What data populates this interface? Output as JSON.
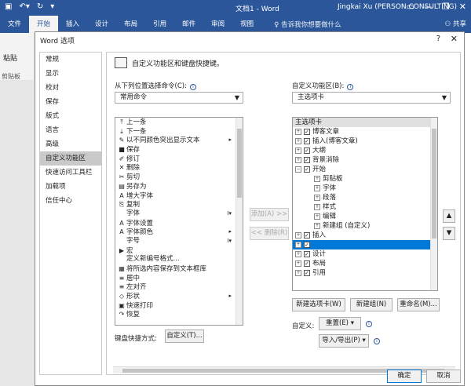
{
  "titlebar": {
    "doc_title": "文档1 - Word",
    "user": "Jingkai Xu (PERSON CONSULTING)",
    "save_icon": "save-icon",
    "undo_icon": "undo-icon",
    "redo_icon": "redo-icon",
    "minimize": "—",
    "restore": "❐",
    "close": "✕"
  },
  "ribbon": {
    "tabs": [
      "文件",
      "开始",
      "插入",
      "设计",
      "布局",
      "引用",
      "邮件",
      "审阅",
      "视图"
    ],
    "tell_me": "♀ 告诉我你想要做什么",
    "share": "共享",
    "paste": "粘贴",
    "clipboard": "剪贴板"
  },
  "dialog": {
    "title": "Word 选项",
    "help": "?",
    "close": "✕",
    "nav": [
      "常规",
      "显示",
      "校对",
      "保存",
      "版式",
      "语言",
      "高级",
      "自定义功能区",
      "快速访问工具栏",
      "加载项",
      "信任中心"
    ],
    "heading": "自定义功能区和键盘快捷键。",
    "from_label": "从下列位置选择命令(C):",
    "from_value": "常用命令",
    "customize_label": "自定义功能区(B):",
    "customize_value": "主选项卡",
    "commands": [
      {
        "icon": "⤒",
        "label": "上一条",
        "sub": ""
      },
      {
        "icon": "⤓",
        "label": "下一条",
        "sub": ""
      },
      {
        "icon": "✎",
        "label": "以不同颜色突出显示文本",
        "sub": "▸"
      },
      {
        "icon": "■",
        "label": "保存",
        "sub": ""
      },
      {
        "icon": "✐",
        "label": "修订",
        "sub": ""
      },
      {
        "icon": "✕",
        "label": "删除",
        "sub": ""
      },
      {
        "icon": "✂",
        "label": "剪切",
        "sub": ""
      },
      {
        "icon": "▤",
        "label": "另存为",
        "sub": ""
      },
      {
        "icon": "A",
        "label": "增大字体",
        "sub": ""
      },
      {
        "icon": "⎘",
        "label": "复制",
        "sub": ""
      },
      {
        "icon": "",
        "label": "字体",
        "sub": "I▾"
      },
      {
        "icon": "A",
        "label": "字体设置",
        "sub": ""
      },
      {
        "icon": "A",
        "label": "字体颜色",
        "sub": "▸"
      },
      {
        "icon": "",
        "label": "字号",
        "sub": "I▾"
      },
      {
        "icon": "▶",
        "label": "宏",
        "sub": ""
      },
      {
        "icon": "",
        "label": "定义新编号格式...",
        "sub": ""
      },
      {
        "icon": "▦",
        "label": "将所选内容保存到文本框库",
        "sub": ""
      },
      {
        "icon": "≡",
        "label": "居中",
        "sub": ""
      },
      {
        "icon": "≡",
        "label": "左对齐",
        "sub": ""
      },
      {
        "icon": "◇",
        "label": "形状",
        "sub": "▸"
      },
      {
        "icon": "▣",
        "label": "快速打印",
        "sub": ""
      },
      {
        "icon": "↷",
        "label": "恢复",
        "sub": ""
      }
    ],
    "add_button": "添加(A) >>",
    "remove_button": "<< 删除(R)",
    "tree": [
      {
        "expander": "",
        "checked": null,
        "indent": 0,
        "label": "主选项卡",
        "selected": false,
        "header": true
      },
      {
        "expander": "+",
        "checked": true,
        "indent": 0,
        "label": "博客文章",
        "selected": false,
        "header": false
      },
      {
        "expander": "+",
        "checked": true,
        "indent": 0,
        "label": "插入(博客文章)",
        "selected": false,
        "header": false
      },
      {
        "expander": "+",
        "checked": true,
        "indent": 0,
        "label": "大纲",
        "selected": false,
        "header": false
      },
      {
        "expander": "+",
        "checked": true,
        "indent": 0,
        "label": "背景消除",
        "selected": false,
        "header": false
      },
      {
        "expander": "−",
        "checked": true,
        "indent": 0,
        "label": "开始",
        "selected": false,
        "header": false
      },
      {
        "expander": "+",
        "checked": null,
        "indent": 2,
        "label": "剪贴板",
        "selected": false,
        "header": false
      },
      {
        "expander": "+",
        "checked": null,
        "indent": 2,
        "label": "字体",
        "selected": false,
        "header": false
      },
      {
        "expander": "+",
        "checked": null,
        "indent": 2,
        "label": "段落",
        "selected": false,
        "header": false
      },
      {
        "expander": "+",
        "checked": null,
        "indent": 2,
        "label": "样式",
        "selected": false,
        "header": false
      },
      {
        "expander": "+",
        "checked": null,
        "indent": 2,
        "label": "编辑",
        "selected": false,
        "header": false
      },
      {
        "expander": "+",
        "checked": null,
        "indent": 2,
        "label": "新建组 (自定义)",
        "selected": false,
        "header": false
      },
      {
        "expander": "+",
        "checked": true,
        "indent": 0,
        "label": "插入",
        "selected": false,
        "header": false
      },
      {
        "expander": "+",
        "checked": true,
        "indent": 0,
        "label": "",
        "selected": true,
        "header": false
      },
      {
        "expander": "+",
        "checked": true,
        "indent": 0,
        "label": "设计",
        "selected": false,
        "header": false
      },
      {
        "expander": "+",
        "checked": true,
        "indent": 0,
        "label": "布局",
        "selected": false,
        "header": false
      },
      {
        "expander": "+",
        "checked": true,
        "indent": 0,
        "label": "引用",
        "selected": false,
        "header": false
      }
    ],
    "move_up": "▲",
    "move_down": "▼",
    "new_tab": "新建选项卡(W)",
    "new_group": "新建组(N)",
    "rename": "重命名(M)...",
    "custom_label": "自定义:",
    "reset": "重置(E) ▾",
    "import_export": "导入/导出(P) ▾",
    "keyboard_label": "键盘快捷方式:",
    "keyboard_button": "自定义(T)...",
    "ok": "确定",
    "cancel": "取消"
  },
  "colors": {
    "brand": "#2b579a",
    "selection": "#0078d7"
  }
}
